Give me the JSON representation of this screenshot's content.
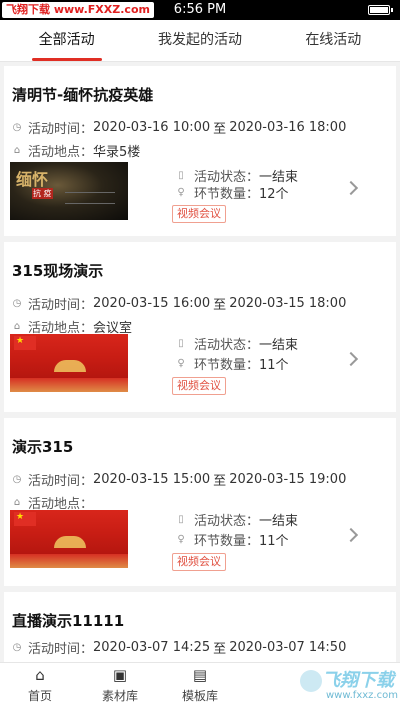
{
  "status_bar": {
    "watermark": "飞翔下载 www.FXXZ.com",
    "time": "6:56 PM",
    "battery_level": 1.0
  },
  "tabs": [
    {
      "label": "全部活动",
      "active": true
    },
    {
      "label": "我发起的活动",
      "active": false
    },
    {
      "label": "在线活动",
      "active": false
    }
  ],
  "labels": {
    "time": "活动时间：",
    "place": "活动地点：",
    "status": "活动状态：",
    "count": "环节数量：",
    "to": "至"
  },
  "cards": [
    {
      "title": "清明节-缅怀抗疫英雄",
      "start": "2020-03-16 10:00",
      "end": "2020-03-16 18:00",
      "place": "华录5楼",
      "status": "一结束",
      "count": "12个",
      "badge": "视频会议",
      "thumb_text": "缅怀",
      "thumb_sub": "抗 疫"
    },
    {
      "title": "315现场演示",
      "start": "2020-03-15 16:00",
      "end": "2020-03-15 18:00",
      "place": "会议室",
      "status": "一结束",
      "count": "11个",
      "badge": "视频会议"
    },
    {
      "title": "演示315",
      "start": "2020-03-15 15:00",
      "end": "2020-03-15 19:00",
      "place": "",
      "status": "一结束",
      "count": "11个",
      "badge": "视频会议"
    },
    {
      "title": "直播演示11111",
      "start": "2020-03-07 14:25",
      "end": "2020-03-07 14:50"
    }
  ],
  "bottom_nav": [
    {
      "label": "首页",
      "icon": "home-icon"
    },
    {
      "label": "素材库",
      "icon": "archive-icon"
    },
    {
      "label": "模板库",
      "icon": "template-icon"
    }
  ],
  "logo_watermark": {
    "title": "飞翔下载",
    "url": "www.fxxz.com"
  }
}
